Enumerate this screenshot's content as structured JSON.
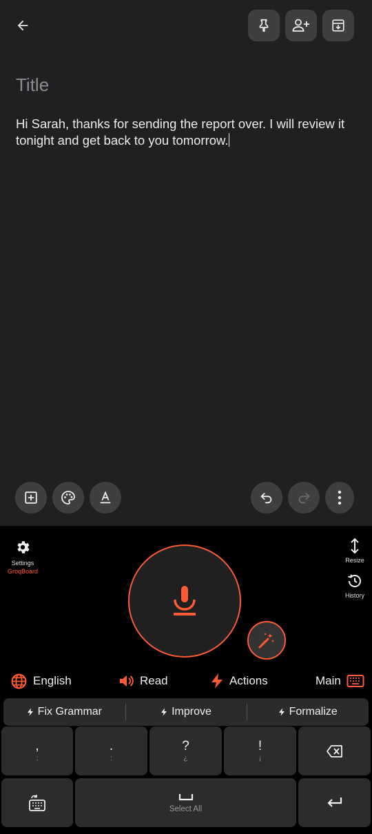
{
  "note": {
    "title_placeholder": "Title",
    "body": "Hi Sarah, thanks for sending the report over. I will review it tonight and get back to you tomorrow."
  },
  "keyboard": {
    "settings_label": "Settings",
    "brand": "GroqBoard",
    "resize_label": "Resize",
    "history_label": "History",
    "modes": {
      "language": "English",
      "read": "Read",
      "actions": "Actions",
      "main": "Main"
    },
    "suggestions": [
      "Fix Grammar",
      "Improve",
      "Formalize"
    ],
    "keys": [
      {
        "main": ",",
        "sub": ";"
      },
      {
        "main": ".",
        "sub": ":"
      },
      {
        "main": "?",
        "sub": "¿"
      },
      {
        "main": "!",
        "sub": "¡"
      }
    ],
    "space_label": "Select All"
  },
  "colors": {
    "accent": "#ff5a36",
    "note_bg": "#202023",
    "keyboard_bg": "#000000",
    "key_bg": "#2c2c2c"
  },
  "icons": {
    "back": "arrow-left-icon",
    "pin": "pin-icon",
    "collaborator": "person-add-icon",
    "archive": "archive-icon",
    "add_box": "add-box-icon",
    "palette": "palette-icon",
    "text_format": "text-format-icon",
    "undo": "undo-icon",
    "redo": "redo-icon",
    "more": "more-vert-icon",
    "settings": "gear-icon",
    "resize": "resize-icon",
    "history": "history-icon",
    "mic": "mic-icon",
    "magic": "magic-wand-icon",
    "language": "globe-icon",
    "read": "speaker-icon",
    "actions": "bolt-icon",
    "main": "keyboard-icon",
    "backspace": "backspace-icon",
    "switch_keyboard": "keyboard-switch-icon",
    "enter": "enter-icon"
  }
}
